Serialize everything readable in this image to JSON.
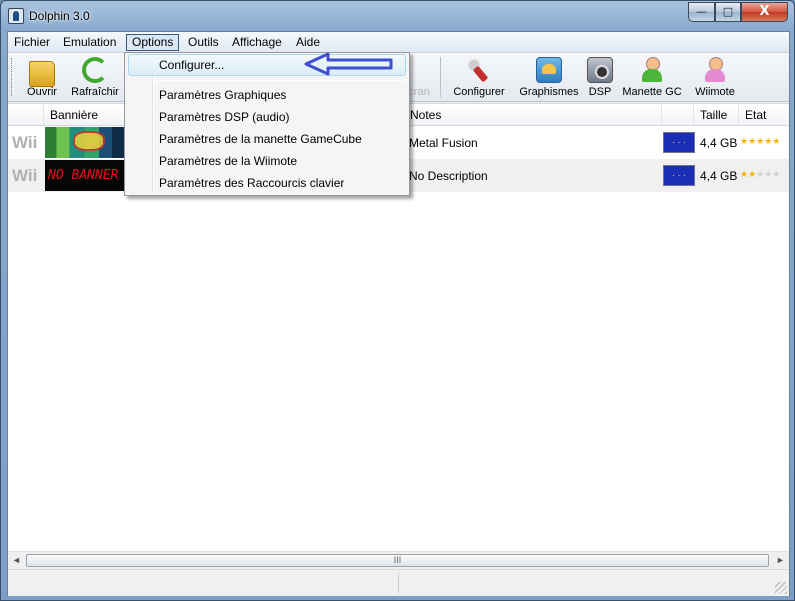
{
  "window": {
    "title": "Dolphin 3.0",
    "controls": {
      "minimize": "—",
      "maximize": "□",
      "close": "X"
    }
  },
  "menubar": [
    "Fichier",
    "Emulation",
    "Options",
    "Outils",
    "Affichage",
    "Aide"
  ],
  "toolbar": {
    "open": "Ouvrir",
    "refresh": "Rafraîchir",
    "partial": "cran",
    "configure": "Configurer",
    "graphics": "Graphismes",
    "dsp": "DSP",
    "gc_pad": "Manette GC",
    "wiimote": "Wiimote"
  },
  "columns": {
    "banner": "Bannière",
    "notes": "Notes",
    "size": "Taille",
    "state": "Etat"
  },
  "games": [
    {
      "platform": "Wii",
      "banner_text": "",
      "notes": "Metal Fusion",
      "size": "4,4 GB",
      "rating": 5
    },
    {
      "platform": "Wii",
      "banner_text": "NO BANNER",
      "notes": "No Description",
      "size": "4,4 GB",
      "rating": 2
    }
  ],
  "options_menu": {
    "items": [
      "Configurer...",
      "Paramètres Graphiques",
      "Paramètres DSP (audio)",
      "Paramètres de la manette GameCube",
      "Paramètres de la Wiimote",
      "Paramètres des Raccourcis clavier"
    ],
    "highlighted_index": 0
  },
  "scrollbar": {
    "left": "◄",
    "right": "►",
    "grip": "III"
  },
  "colors": {
    "annotation_arrow": "#3b4fd0",
    "eu_flag": "#1a2fb6",
    "star": "#f2b400"
  }
}
